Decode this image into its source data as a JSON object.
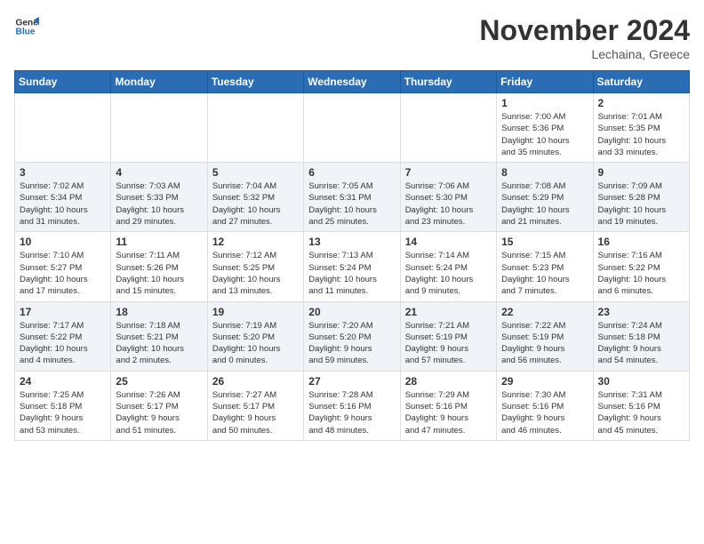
{
  "header": {
    "logo_line1": "General",
    "logo_line2": "Blue",
    "month": "November 2024",
    "location": "Lechaina, Greece"
  },
  "weekdays": [
    "Sunday",
    "Monday",
    "Tuesday",
    "Wednesday",
    "Thursday",
    "Friday",
    "Saturday"
  ],
  "weeks": [
    [
      {
        "day": "",
        "info": ""
      },
      {
        "day": "",
        "info": ""
      },
      {
        "day": "",
        "info": ""
      },
      {
        "day": "",
        "info": ""
      },
      {
        "day": "",
        "info": ""
      },
      {
        "day": "1",
        "info": "Sunrise: 7:00 AM\nSunset: 5:36 PM\nDaylight: 10 hours\nand 35 minutes."
      },
      {
        "day": "2",
        "info": "Sunrise: 7:01 AM\nSunset: 5:35 PM\nDaylight: 10 hours\nand 33 minutes."
      }
    ],
    [
      {
        "day": "3",
        "info": "Sunrise: 7:02 AM\nSunset: 5:34 PM\nDaylight: 10 hours\nand 31 minutes."
      },
      {
        "day": "4",
        "info": "Sunrise: 7:03 AM\nSunset: 5:33 PM\nDaylight: 10 hours\nand 29 minutes."
      },
      {
        "day": "5",
        "info": "Sunrise: 7:04 AM\nSunset: 5:32 PM\nDaylight: 10 hours\nand 27 minutes."
      },
      {
        "day": "6",
        "info": "Sunrise: 7:05 AM\nSunset: 5:31 PM\nDaylight: 10 hours\nand 25 minutes."
      },
      {
        "day": "7",
        "info": "Sunrise: 7:06 AM\nSunset: 5:30 PM\nDaylight: 10 hours\nand 23 minutes."
      },
      {
        "day": "8",
        "info": "Sunrise: 7:08 AM\nSunset: 5:29 PM\nDaylight: 10 hours\nand 21 minutes."
      },
      {
        "day": "9",
        "info": "Sunrise: 7:09 AM\nSunset: 5:28 PM\nDaylight: 10 hours\nand 19 minutes."
      }
    ],
    [
      {
        "day": "10",
        "info": "Sunrise: 7:10 AM\nSunset: 5:27 PM\nDaylight: 10 hours\nand 17 minutes."
      },
      {
        "day": "11",
        "info": "Sunrise: 7:11 AM\nSunset: 5:26 PM\nDaylight: 10 hours\nand 15 minutes."
      },
      {
        "day": "12",
        "info": "Sunrise: 7:12 AM\nSunset: 5:25 PM\nDaylight: 10 hours\nand 13 minutes."
      },
      {
        "day": "13",
        "info": "Sunrise: 7:13 AM\nSunset: 5:24 PM\nDaylight: 10 hours\nand 11 minutes."
      },
      {
        "day": "14",
        "info": "Sunrise: 7:14 AM\nSunset: 5:24 PM\nDaylight: 10 hours\nand 9 minutes."
      },
      {
        "day": "15",
        "info": "Sunrise: 7:15 AM\nSunset: 5:23 PM\nDaylight: 10 hours\nand 7 minutes."
      },
      {
        "day": "16",
        "info": "Sunrise: 7:16 AM\nSunset: 5:22 PM\nDaylight: 10 hours\nand 6 minutes."
      }
    ],
    [
      {
        "day": "17",
        "info": "Sunrise: 7:17 AM\nSunset: 5:22 PM\nDaylight: 10 hours\nand 4 minutes."
      },
      {
        "day": "18",
        "info": "Sunrise: 7:18 AM\nSunset: 5:21 PM\nDaylight: 10 hours\nand 2 minutes."
      },
      {
        "day": "19",
        "info": "Sunrise: 7:19 AM\nSunset: 5:20 PM\nDaylight: 10 hours\nand 0 minutes."
      },
      {
        "day": "20",
        "info": "Sunrise: 7:20 AM\nSunset: 5:20 PM\nDaylight: 9 hours\nand 59 minutes."
      },
      {
        "day": "21",
        "info": "Sunrise: 7:21 AM\nSunset: 5:19 PM\nDaylight: 9 hours\nand 57 minutes."
      },
      {
        "day": "22",
        "info": "Sunrise: 7:22 AM\nSunset: 5:19 PM\nDaylight: 9 hours\nand 56 minutes."
      },
      {
        "day": "23",
        "info": "Sunrise: 7:24 AM\nSunset: 5:18 PM\nDaylight: 9 hours\nand 54 minutes."
      }
    ],
    [
      {
        "day": "24",
        "info": "Sunrise: 7:25 AM\nSunset: 5:18 PM\nDaylight: 9 hours\nand 53 minutes."
      },
      {
        "day": "25",
        "info": "Sunrise: 7:26 AM\nSunset: 5:17 PM\nDaylight: 9 hours\nand 51 minutes."
      },
      {
        "day": "26",
        "info": "Sunrise: 7:27 AM\nSunset: 5:17 PM\nDaylight: 9 hours\nand 50 minutes."
      },
      {
        "day": "27",
        "info": "Sunrise: 7:28 AM\nSunset: 5:16 PM\nDaylight: 9 hours\nand 48 minutes."
      },
      {
        "day": "28",
        "info": "Sunrise: 7:29 AM\nSunset: 5:16 PM\nDaylight: 9 hours\nand 47 minutes."
      },
      {
        "day": "29",
        "info": "Sunrise: 7:30 AM\nSunset: 5:16 PM\nDaylight: 9 hours\nand 46 minutes."
      },
      {
        "day": "30",
        "info": "Sunrise: 7:31 AM\nSunset: 5:16 PM\nDaylight: 9 hours\nand 45 minutes."
      }
    ]
  ]
}
